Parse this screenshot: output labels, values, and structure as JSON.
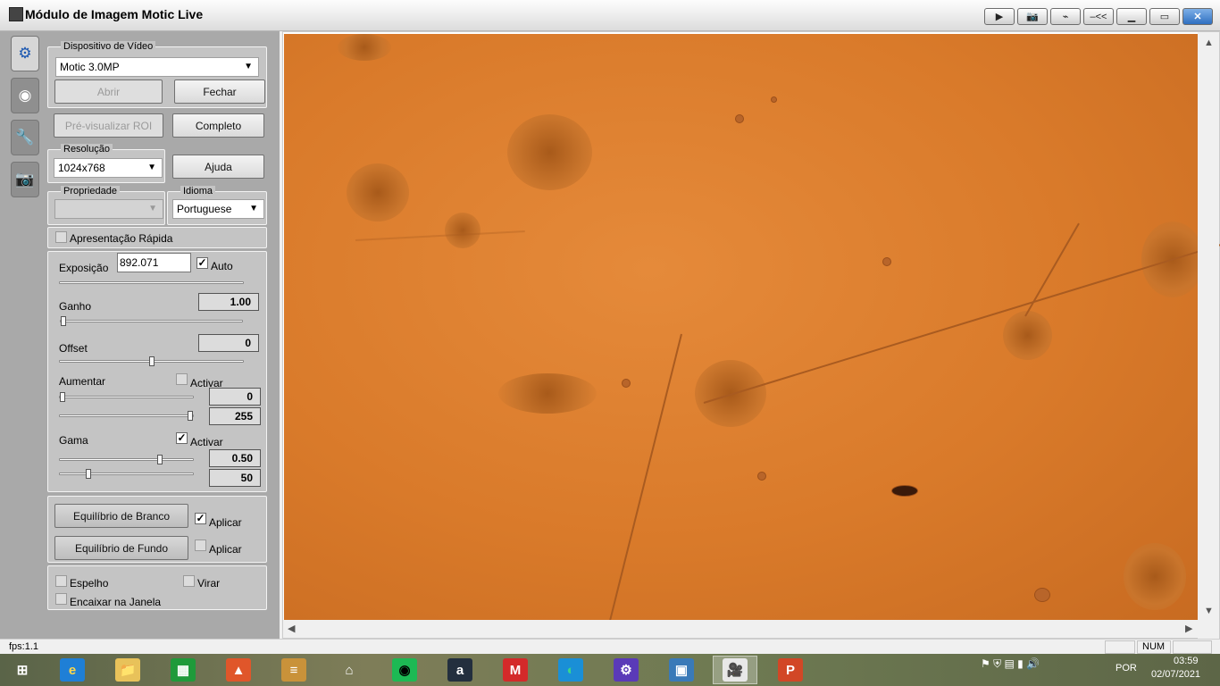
{
  "window": {
    "title": "Módulo de Imagem Motic Live"
  },
  "title_buttons": [
    {
      "name": "play-icon",
      "glyph": "▶"
    },
    {
      "name": "camera-icon",
      "glyph": "📷"
    },
    {
      "name": "bar-icon",
      "glyph": "⌁"
    },
    {
      "name": "collapse-icon",
      "glyph": "–<<"
    },
    {
      "name": "minimize-icon",
      "glyph": "▁"
    },
    {
      "name": "maximize-icon",
      "glyph": "▭"
    },
    {
      "name": "close-icon",
      "glyph": "✕"
    }
  ],
  "panel": {
    "video_device": {
      "legend": "Dispositivo de Vídeo",
      "selected": "Motic 3.0MP",
      "open_label": "Abrir",
      "close_label": "Fechar"
    },
    "preview_roi_label": "Pré-visualizar ROI",
    "complete_label": "Completo",
    "resolution": {
      "legend": "Resolução",
      "selected": "1024x768"
    },
    "help_label": "Ajuda",
    "property": {
      "legend": "Propriedade",
      "selected": ""
    },
    "language": {
      "legend": "Idioma",
      "selected": "Portuguese"
    },
    "quick_presentation": {
      "label": "Apresentação Rápida",
      "checked": false
    },
    "exposure": {
      "label": "Exposição",
      "value": "892.071",
      "auto_label": "Auto",
      "auto_checked": true
    },
    "gain": {
      "label": "Ganho",
      "value": "1.00",
      "slider": 0.0
    },
    "offset": {
      "label": "Offset",
      "value": "0",
      "slider": 0.5
    },
    "enhance": {
      "label": "Aumentar",
      "activate_label": "Activar",
      "activate_checked": false,
      "low": "0",
      "high": "255",
      "low_slider": 0.0,
      "high_slider": 1.0
    },
    "gamma": {
      "label": "Gama",
      "activate_label": "Activar",
      "activate_checked": true,
      "gamma_value": "0.50",
      "contrast_value": "50",
      "gamma_slider": 0.76,
      "contrast_slider": 0.2
    },
    "white_balance": {
      "label": "Equilíbrio de Branco",
      "apply_label": "Aplicar",
      "apply_checked": true
    },
    "background_balance": {
      "label": "Equilíbrio de Fundo",
      "apply_label": "Aplicar",
      "apply_checked": false
    },
    "mirror": {
      "label": "Espelho",
      "checked": false
    },
    "flip": {
      "label": "Virar",
      "checked": false
    },
    "fit_window": {
      "label": "Encaixar na Janela",
      "checked": false
    }
  },
  "status": {
    "fps": "fps:1.1",
    "num": "NUM"
  },
  "taskbar": {
    "apps": [
      {
        "name": "start-button",
        "glyph": "⊞",
        "bg": "transparent",
        "fg": "#ffffff"
      },
      {
        "name": "internet-explorer-icon",
        "glyph": "e",
        "bg": "#1f7fd6",
        "fg": "#ffd84a"
      },
      {
        "name": "file-explorer-icon",
        "glyph": "📁",
        "bg": "#e8c25a",
        "fg": "#6b4a12"
      },
      {
        "name": "store-icon",
        "glyph": "▦",
        "bg": "#1f9a3a",
        "fg": "#ffffff"
      },
      {
        "name": "photos-icon",
        "glyph": "▲",
        "bg": "#e0562a",
        "fg": "#ffffff"
      },
      {
        "name": "notes-app-icon",
        "glyph": "≡",
        "bg": "#c9923a",
        "fg": "#ffffff"
      },
      {
        "name": "home-icon",
        "glyph": "⌂",
        "bg": "transparent",
        "fg": "#ffffff"
      },
      {
        "name": "spotify-icon",
        "glyph": "◉",
        "bg": "#1db954",
        "fg": "#000000"
      },
      {
        "name": "amazon-icon",
        "glyph": "a",
        "bg": "#232f3e",
        "fg": "#ffffff"
      },
      {
        "name": "motic-app-icon",
        "glyph": "M",
        "bg": "#d42a2a",
        "fg": "#ffffff"
      },
      {
        "name": "edge-icon",
        "glyph": "◐",
        "bg": "#1a8fd6",
        "fg": "#3ad68a"
      },
      {
        "name": "settings-app-icon",
        "glyph": "⚙",
        "bg": "#5a3ab8",
        "fg": "#ffffff"
      },
      {
        "name": "image-viewer-icon",
        "glyph": "▣",
        "bg": "#3a7ab8",
        "fg": "#ffffff"
      },
      {
        "name": "motic-live-icon",
        "glyph": "🎥",
        "bg": "#e8e8e8",
        "fg": "#222222"
      },
      {
        "name": "powerpoint-icon",
        "glyph": "P",
        "bg": "#d24726",
        "fg": "#ffffff"
      }
    ],
    "tray": {
      "language": "POR",
      "time": "03:59",
      "date": "02/07/2021"
    }
  }
}
